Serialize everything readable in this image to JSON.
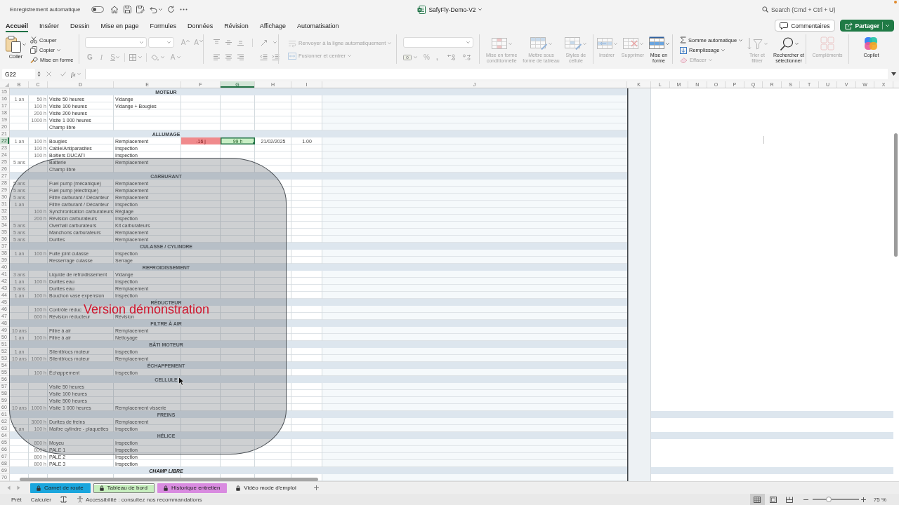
{
  "title_bar": {
    "autosave_label": "Enregistrement automatique",
    "autosave_on": false,
    "document_title": "SafyFly-Demo-V2",
    "search_placeholder": "Search (Cmd + Ctrl + U)"
  },
  "ribbon_tabs": [
    {
      "label": "Accueil",
      "selected": true
    },
    {
      "label": "Insérer",
      "selected": false
    },
    {
      "label": "Dessin",
      "selected": false
    },
    {
      "label": "Mise en page",
      "selected": false
    },
    {
      "label": "Formules",
      "selected": false
    },
    {
      "label": "Données",
      "selected": false
    },
    {
      "label": "Révision",
      "selected": false
    },
    {
      "label": "Affichage",
      "selected": false
    },
    {
      "label": "Automatisation",
      "selected": false
    }
  ],
  "header_buttons": [
    {
      "kind": "comments",
      "label": "Commentaires"
    },
    {
      "kind": "share",
      "label": "Partager"
    }
  ],
  "ribbon": {
    "clipboard": {
      "paste": "Coller",
      "items": [
        {
          "kind": "cut",
          "label": "Couper"
        },
        {
          "kind": "copy",
          "label": "Copier"
        },
        {
          "kind": "format_painter",
          "label": "Mise en forme"
        }
      ]
    },
    "font": {
      "size_buttons": [
        {
          "kind": "grow",
          "label": "A",
          "disabled": true
        },
        {
          "kind": "shrink",
          "label": "A",
          "disabled": true
        }
      ],
      "style_buttons": [
        {
          "kind": "bold",
          "label": "G",
          "disabled": true
        },
        {
          "kind": "italic",
          "label": "I",
          "disabled": true
        },
        {
          "kind": "underline",
          "label": "S",
          "disabled": true
        }
      ],
      "color_button": {
        "label": "A",
        "disabled": true
      }
    },
    "wrap_merge": [
      {
        "kind": "wrap",
        "label": "Renvoyer à la ligne automatiquement",
        "disabled": true
      },
      {
        "kind": "merge",
        "label": "Fusionner et centrer",
        "disabled": true
      }
    ],
    "number_buttons": [
      {
        "kind": "percent",
        "label": "%",
        "disabled": true
      },
      {
        "kind": "thousands",
        "label": ",",
        "disabled": true
      }
    ],
    "styles": [
      {
        "kind": "conditional",
        "label": "Mise en forme conditionnelle",
        "disabled": true
      },
      {
        "kind": "table",
        "label": "Mettre sous forme de tableau",
        "disabled": true
      },
      {
        "kind": "cell_styles",
        "label": "Styles de cellule",
        "disabled": true
      }
    ],
    "cells": [
      {
        "kind": "insert",
        "label": "Insérer",
        "disabled": true
      },
      {
        "kind": "delete",
        "label": "Supprimer",
        "disabled": true
      },
      {
        "kind": "format",
        "label": "Mise en forme",
        "disabled": false
      }
    ],
    "editing": [
      {
        "kind": "autosum",
        "label": "Somme automatique",
        "disabled": false
      },
      {
        "kind": "fill",
        "label": "Remplissage",
        "disabled": false
      },
      {
        "kind": "clear",
        "label": "Effacer",
        "disabled": true
      }
    ],
    "sort_find": [
      {
        "kind": "sort",
        "label": "Trier et filtrer",
        "disabled": true
      },
      {
        "kind": "find",
        "label": "Rechercher et sélectionner",
        "disabled": false
      }
    ],
    "add_ins": {
      "label": "Compléments",
      "disabled": true
    },
    "copilot": {
      "label": "Copilot"
    }
  },
  "formula_bar": {
    "name_box": "G22",
    "function_label": "fx"
  },
  "sheet": {
    "columns": [
      {
        "letter": "B",
        "selected": false
      },
      {
        "letter": "C",
        "selected": false
      },
      {
        "letter": "D",
        "selected": false
      },
      {
        "letter": "E",
        "selected": false
      },
      {
        "letter": "F",
        "selected": false
      },
      {
        "letter": "G",
        "selected": true
      },
      {
        "letter": "H",
        "selected": false
      },
      {
        "letter": "I",
        "selected": false
      },
      {
        "letter": "J",
        "selected": false
      },
      {
        "letter": "K",
        "selected": false
      },
      {
        "letter": "L",
        "selected": false
      },
      {
        "letter": "M",
        "selected": false
      },
      {
        "letter": "N",
        "selected": false
      },
      {
        "letter": "O",
        "selected": false
      },
      {
        "letter": "P",
        "selected": false
      },
      {
        "letter": "Q",
        "selected": false
      },
      {
        "letter": "R",
        "selected": false
      },
      {
        "letter": "S",
        "selected": false
      },
      {
        "letter": "T",
        "selected": false
      },
      {
        "letter": "U",
        "selected": false
      },
      {
        "letter": "V",
        "selected": false
      },
      {
        "letter": "W",
        "selected": false
      },
      {
        "letter": "X",
        "selected": false
      }
    ],
    "rows": [
      {
        "number": "15",
        "selected": false,
        "kind": "section",
        "title": "MOTEUR",
        "italic": false,
        "band_wide": false
      },
      {
        "number": "16",
        "selected": false,
        "kind": "item",
        "cells": {
          "column_b": "1 an",
          "column_c": "50 h",
          "column_d": "Visite 50 heures",
          "column_e": "Vidange"
        }
      },
      {
        "number": "17",
        "selected": false,
        "kind": "item",
        "cells": {
          "column_c": "100 h",
          "column_d": "Visite 100 heures",
          "column_e": "Vidange + Bougies"
        }
      },
      {
        "number": "18",
        "selected": false,
        "kind": "item",
        "cells": {
          "column_c": "200 h",
          "column_d": "Visite 200 heures"
        }
      },
      {
        "number": "19",
        "selected": false,
        "kind": "item",
        "cells": {
          "column_c": "1000 h",
          "column_d": "Visite 1 000 heures"
        }
      },
      {
        "number": "20",
        "selected": false,
        "kind": "item",
        "cells": {
          "column_d": "Champ libre"
        }
      },
      {
        "number": "21",
        "selected": false,
        "kind": "section",
        "title": "ALLUMAGE",
        "italic": false,
        "band_wide": false
      },
      {
        "number": "22",
        "selected": true,
        "kind": "item",
        "cells": {
          "column_b": "1 an",
          "column_c": "100 h",
          "column_d": "Bougies",
          "column_e": "Remplacement",
          "column_f": {
            "text": "-16 j",
            "color": "#f08a8c"
          },
          "column_g": {
            "text": "99 h",
            "color": "#c9efc5"
          },
          "column_h": "21/02/2025",
          "column_i": "1.00"
        }
      },
      {
        "number": "23",
        "selected": false,
        "kind": "item",
        "cells": {
          "column_c": "100 h",
          "column_d": "Cable/Antiparasites",
          "column_e": "Inspection"
        }
      },
      {
        "number": "24",
        "selected": false,
        "kind": "item",
        "cells": {
          "column_c": "100 h",
          "column_d": "Boitiers DUCATI",
          "column_e": "Inspection"
        }
      },
      {
        "number": "25",
        "selected": false,
        "kind": "item",
        "cells": {
          "column_b": "5 ans",
          "column_d": "Batterie",
          "column_e": "Remplacement"
        }
      },
      {
        "number": "26",
        "selected": false,
        "kind": "item",
        "cells": {
          "column_d": "Champ libre"
        }
      },
      {
        "number": "27",
        "selected": false,
        "kind": "section",
        "title": "CARBURANT",
        "italic": false,
        "band_wide": false
      },
      {
        "number": "28",
        "selected": false,
        "kind": "item",
        "cells": {
          "column_b": "5 ans",
          "column_d": "Fuel pump (mécanique)",
          "column_e": "Remplacement"
        }
      },
      {
        "number": "29",
        "selected": false,
        "kind": "item",
        "cells": {
          "column_b": "5 ans",
          "column_d": "Fuel pump (électrique)",
          "column_e": "Remplacement"
        }
      },
      {
        "number": "30",
        "selected": false,
        "kind": "item",
        "cells": {
          "column_b": "5 ans",
          "column_d": "Filtre carburant / Décanteur",
          "column_e": "Remplacement"
        }
      },
      {
        "number": "31",
        "selected": false,
        "kind": "item",
        "cells": {
          "column_b": "1 an",
          "column_d": "Filtre carburant / Décanteur",
          "column_e": "Inspection"
        }
      },
      {
        "number": "32",
        "selected": false,
        "kind": "item",
        "cells": {
          "column_c": "100 h",
          "column_d": "Synchronisation carburateurs",
          "column_e": "Réglage"
        }
      },
      {
        "number": "33",
        "selected": false,
        "kind": "item",
        "cells": {
          "column_c": "200 h",
          "column_d": "Révision carburateurs",
          "column_e": "Inspection"
        }
      },
      {
        "number": "34",
        "selected": false,
        "kind": "item",
        "cells": {
          "column_b": "5 ans",
          "column_d": "Overhall carburateurs",
          "column_e": "Kit carburateurs"
        }
      },
      {
        "number": "35",
        "selected": false,
        "kind": "item",
        "cells": {
          "column_b": "5 ans",
          "column_d": "Manchons carburateurs",
          "column_e": "Remplacement"
        }
      },
      {
        "number": "36",
        "selected": false,
        "kind": "item",
        "cells": {
          "column_b": "5 ans",
          "column_d": "Durites",
          "column_e": "Remplacement"
        }
      },
      {
        "number": "37",
        "selected": false,
        "kind": "section",
        "title": "CULASSE / CYLINDRE",
        "italic": false,
        "band_wide": false
      },
      {
        "number": "38",
        "selected": false,
        "kind": "item",
        "cells": {
          "column_b": "1 an",
          "column_c": "100 h",
          "column_d": "Fuite joint culasse",
          "column_e": "Inspection"
        }
      },
      {
        "number": "39",
        "selected": false,
        "kind": "item",
        "cells": {
          "column_d": "Resserrage culasse",
          "column_e": "Serrage"
        }
      },
      {
        "number": "40",
        "selected": false,
        "kind": "section",
        "title": "REFROIDISSEMENT",
        "italic": false,
        "band_wide": false
      },
      {
        "number": "41",
        "selected": false,
        "kind": "item",
        "cells": {
          "column_b": "3 ans",
          "column_d": "Liquide de refroidissement",
          "column_e": "Vidange"
        }
      },
      {
        "number": "42",
        "selected": false,
        "kind": "item",
        "cells": {
          "column_b": "1 an",
          "column_c": "100 h",
          "column_d": "Durites eau",
          "column_e": "Inspection"
        }
      },
      {
        "number": "43",
        "selected": false,
        "kind": "item",
        "cells": {
          "column_b": "5 ans",
          "column_d": "Durites eau",
          "column_e": "Remplacement"
        }
      },
      {
        "number": "44",
        "selected": false,
        "kind": "item",
        "cells": {
          "column_b": "1 an",
          "column_c": "100 h",
          "column_d": "Bouchon vase expension",
          "column_e": "Inspection"
        }
      },
      {
        "number": "45",
        "selected": false,
        "kind": "section",
        "title": "RÉDUCTEUR",
        "italic": false,
        "band_wide": false
      },
      {
        "number": "46",
        "selected": false,
        "kind": "item",
        "cells": {
          "column_c": "100 h",
          "column_d": "Contrôle réduc"
        }
      },
      {
        "number": "47",
        "selected": false,
        "kind": "item",
        "cells": {
          "column_c": "600 h",
          "column_d": "Révision réducteur",
          "column_e": "Révision"
        }
      },
      {
        "number": "48",
        "selected": false,
        "kind": "section",
        "title": "FILTRE À AIR",
        "italic": false,
        "band_wide": false
      },
      {
        "number": "49",
        "selected": false,
        "kind": "item",
        "cells": {
          "column_b": "10 ans",
          "column_d": "Filtre à air",
          "column_e": "Remplacement"
        }
      },
      {
        "number": "50",
        "selected": false,
        "kind": "item",
        "cells": {
          "column_b": "1 an",
          "column_c": "100 h",
          "column_d": "Filtre à air",
          "column_e": "Nettoyage"
        }
      },
      {
        "number": "51",
        "selected": false,
        "kind": "section",
        "title": "BÂTI MOTEUR",
        "italic": false,
        "band_wide": false
      },
      {
        "number": "52",
        "selected": false,
        "kind": "item",
        "cells": {
          "column_b": "1 an",
          "column_d": "Silentblocs moteur",
          "column_e": "Inspection"
        }
      },
      {
        "number": "53",
        "selected": false,
        "kind": "item",
        "cells": {
          "column_b": "10 ans",
          "column_c": "1000 h",
          "column_d": "Silentblocs moteur",
          "column_e": "Remplacement"
        }
      },
      {
        "number": "54",
        "selected": false,
        "kind": "section",
        "title": "ÉCHAPPEMENT",
        "italic": false,
        "band_wide": false
      },
      {
        "number": "55",
        "selected": false,
        "kind": "item",
        "cells": {
          "column_c": "100 h",
          "column_d": "Échappement",
          "column_e": "Inspection"
        }
      },
      {
        "number": "56",
        "selected": false,
        "kind": "section",
        "title": "CELLULE",
        "italic": false,
        "band_wide": false
      },
      {
        "number": "57",
        "selected": false,
        "kind": "item",
        "cells": {
          "column_d": "Visite 50 heures"
        }
      },
      {
        "number": "58",
        "selected": false,
        "kind": "item",
        "cells": {
          "column_d": "Visite 100 heures"
        }
      },
      {
        "number": "59",
        "selected": false,
        "kind": "item",
        "cells": {
          "column_d": "Visite 500 heures"
        }
      },
      {
        "number": "60",
        "selected": false,
        "kind": "item",
        "cells": {
          "column_b": "10 ans",
          "column_c": "1000 h",
          "column_d": "Visite 1 000 heures",
          "column_e": "Remplacement visserie"
        }
      },
      {
        "number": "61",
        "selected": false,
        "kind": "section",
        "title": "FREINS",
        "italic": false,
        "band_wide": true
      },
      {
        "number": "62",
        "selected": false,
        "kind": "item",
        "cells": {
          "column_c": "3000 h",
          "column_d": "Durites de freins",
          "column_e": "Remplacement"
        }
      },
      {
        "number": "63",
        "selected": false,
        "kind": "item",
        "cells": {
          "column_b": "1 an",
          "column_c": "100 h",
          "column_d": "Maître cylindre - plaquettes",
          "column_e": "Inspection"
        }
      },
      {
        "number": "64",
        "selected": false,
        "kind": "section",
        "title": "HÉLICE",
        "italic": false,
        "band_wide": true
      },
      {
        "number": "65",
        "selected": false,
        "kind": "item",
        "cells": {
          "column_c": "800 h",
          "column_d": "Moyeu",
          "column_e": "Inspection"
        }
      },
      {
        "number": "66",
        "selected": false,
        "kind": "item",
        "cells": {
          "column_c": "800 h",
          "column_d": "PALE 1",
          "column_e": "Inspection"
        }
      },
      {
        "number": "67",
        "selected": false,
        "kind": "item",
        "cells": {
          "column_c": "800 h",
          "column_d": "PALE 2",
          "column_e": "Inspection"
        }
      },
      {
        "number": "68",
        "selected": false,
        "kind": "item",
        "cells": {
          "column_c": "800 h",
          "column_d": "PALE 3",
          "column_e": "Inspection"
        }
      },
      {
        "number": "69",
        "selected": false,
        "kind": "section",
        "title": "CHAMP LIBRE",
        "italic": true,
        "band_wide": true
      },
      {
        "number": "70",
        "selected": false,
        "kind": "item"
      }
    ],
    "demo_overlay": {
      "label": "Version démonstration"
    }
  },
  "sheet_tabs": [
    {
      "label": "Carnet de route",
      "color": "#1ba6dd",
      "selected": false
    },
    {
      "label": "Tableau de bord",
      "color": "#c8efbf",
      "selected": true
    },
    {
      "label": "Historique entretien",
      "color": "#d98be0",
      "selected": false
    },
    {
      "label": "Vidéo mode d'emploi",
      "selected": false
    }
  ],
  "status_bar": {
    "ready": "Prêt",
    "calculate": "Calculer",
    "accessibility": "Accessibilité : consultez nos recommandations",
    "views": [
      {
        "kind": "normal",
        "selected": true
      },
      {
        "kind": "page_layout",
        "selected": false
      },
      {
        "kind": "page_break",
        "selected": false
      }
    ],
    "zoom": {
      "level": 0.33,
      "label": "75 %"
    }
  }
}
